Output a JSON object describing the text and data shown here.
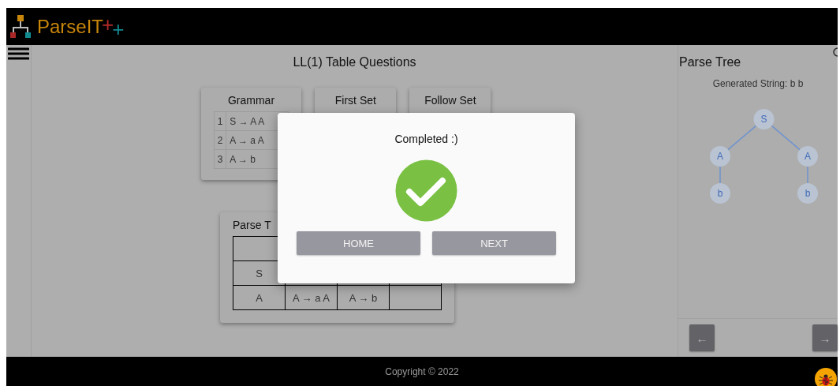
{
  "header": {
    "brand": "ParseIT",
    "marks": [
      {
        "symbol": "+",
        "color": "#b22a2a"
      },
      {
        "symbol": "+",
        "color": "#128a8f"
      }
    ]
  },
  "page": {
    "title": "LL(1) Table Questions",
    "cards": [
      {
        "kind": "grammar",
        "title": "Grammar",
        "rows": [
          {
            "number": "1",
            "rule": "S → A A"
          },
          {
            "number": "2",
            "rule": "A → a A"
          },
          {
            "number": "3",
            "rule": "A → b"
          }
        ]
      },
      {
        "kind": "set",
        "title": "First Set"
      },
      {
        "kind": "set",
        "title": "Follow Set"
      }
    ],
    "parse_table": {
      "title": "Parse T",
      "rows": [
        {
          "nonterminal": "S"
        },
        {
          "nonterminal": "A",
          "cells": [
            "A → a A",
            "A → b"
          ]
        }
      ]
    }
  },
  "parse_tree": {
    "title": "Parse Tree",
    "generated_string": "Generated String: b b",
    "tree": {
      "label": "S",
      "children": [
        {
          "label": "A",
          "children": [
            {
              "label": "b"
            }
          ]
        },
        {
          "label": "A",
          "children": [
            {
              "label": "b"
            }
          ]
        }
      ]
    },
    "nav": [
      "←",
      "→"
    ]
  },
  "footer": {
    "copyright": "Copyright © 2022"
  },
  "dialog": {
    "message": "Completed :)",
    "buttons": [
      "HOME",
      "NEXT"
    ]
  }
}
